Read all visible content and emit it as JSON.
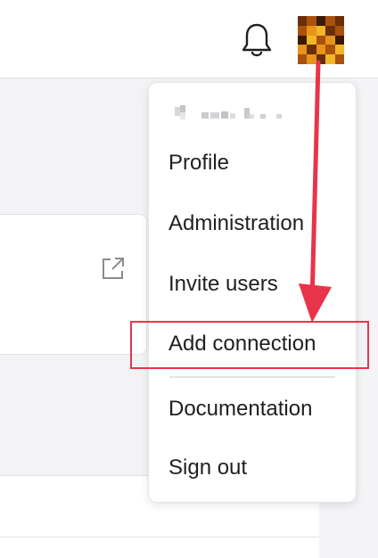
{
  "header": {
    "notifications_icon": "bell-icon",
    "avatar_icon": "user-avatar"
  },
  "user_menu": {
    "items": [
      {
        "label": "Profile"
      },
      {
        "label": "Administration"
      },
      {
        "label": "Invite users"
      },
      {
        "label": "Add connection"
      },
      {
        "label": "Documentation"
      },
      {
        "label": "Sign out"
      }
    ],
    "highlighted_item": "Add connection"
  },
  "card": {
    "open_icon": "external-link-icon"
  },
  "colors": {
    "annotation": "#e8344a",
    "menu_text": "#1f1f22",
    "avatar": [
      "#6b2e08",
      "#a8520d",
      "#e7931c",
      "#f3b629",
      "#3a1a06"
    ]
  }
}
